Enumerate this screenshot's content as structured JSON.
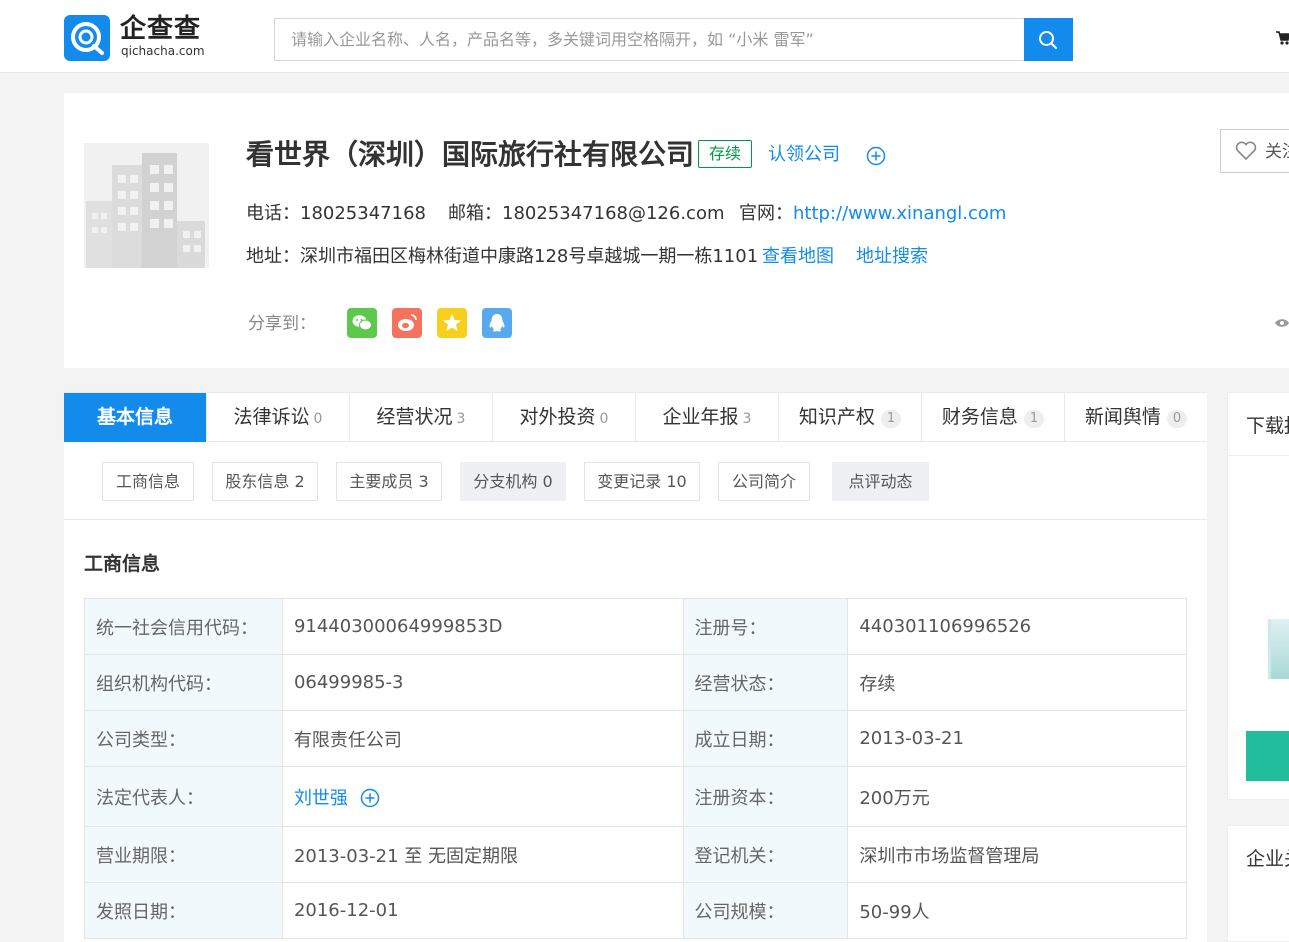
{
  "header": {
    "logo_text": "企查查",
    "logo_sub": "qichacha.com",
    "search_placeholder": "请输入企业名称、人名，产品名等，多关键词用空格隔开，如 “小米 雷军”"
  },
  "company": {
    "name": "看世界（深圳）国际旅行社有限公司",
    "status": "存续",
    "claim": "认领公司",
    "follow": "关注",
    "phone_label": "电话：",
    "phone": "18025347168",
    "email_label": "邮箱：",
    "email": "18025347168@126.com",
    "site_label": "官网：",
    "site": "http://www.xinangl.com",
    "address_label": "地址：",
    "address": "深圳市福田区梅林街道中康路128号卓越城一期一栋1101",
    "map_link": "查看地图",
    "address_search": "地址搜索",
    "share_label": "分享到：",
    "share_icons": [
      "wechat-icon",
      "weibo-icon",
      "qzone-icon",
      "qq-icon"
    ]
  },
  "tabs": [
    {
      "label": "基本信息",
      "count": ""
    },
    {
      "label": "法律诉讼",
      "count": "0"
    },
    {
      "label": "经营状况",
      "count": "3"
    },
    {
      "label": "对外投资",
      "count": "0"
    },
    {
      "label": "企业年报",
      "count": "3"
    },
    {
      "label": "知识产权",
      "count": "1"
    },
    {
      "label": "财务信息",
      "count": "1"
    },
    {
      "label": "新闻舆情",
      "count": "0"
    }
  ],
  "sub_tabs": [
    "工商信息",
    "股东信息 2",
    "主要成员 3",
    "分支机构 0",
    "变更记录 10",
    "公司简介",
    "点评动态"
  ],
  "section_title": "工商信息",
  "biz_table": [
    [
      "统一社会信用代码：",
      "91440300064999853D",
      "注册号：",
      "440301106996526"
    ],
    [
      "组织机构代码：",
      "06499985-3",
      "经营状态：",
      "存续"
    ],
    [
      "公司类型：",
      "有限责任公司",
      "成立日期：",
      "2013-03-21"
    ],
    [
      "法定代表人：",
      "刘世强",
      "注册资本：",
      "200万元"
    ],
    [
      "营业期限：",
      "2013-03-21 至 无固定期限",
      "登记机关：",
      "深圳市市场监督管理局"
    ],
    [
      "发照日期：",
      "2016-12-01",
      "公司规模：",
      "50-99人"
    ]
  ],
  "right_panel": {
    "title": "下载报告",
    "title2": "企业关注"
  },
  "colors": {
    "brand": "#128bed",
    "status_green": "#009944",
    "teal_button": "#21bd9d"
  }
}
